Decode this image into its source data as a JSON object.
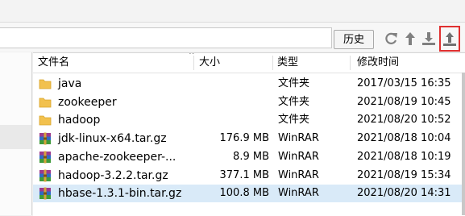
{
  "toolbar": {
    "history_label": "历史",
    "icons": [
      "refresh-icon",
      "arrow-up-icon",
      "download-icon",
      "upload-icon"
    ]
  },
  "columns": {
    "name": "文件名",
    "size": "大小",
    "type": "类型",
    "modified": "修改时间"
  },
  "sort": {
    "column": "name",
    "direction": "ascending",
    "indicator": "^"
  },
  "files": [
    {
      "name": "java",
      "size": "",
      "type": "文件夹",
      "modified": "2017/03/15 16:35",
      "icon": "folder-icon"
    },
    {
      "name": "zookeeper",
      "size": "",
      "type": "文件夹",
      "modified": "2021/08/19 10:45",
      "icon": "folder-icon"
    },
    {
      "name": "hadoop",
      "size": "",
      "type": "文件夹",
      "modified": "2021/08/20 10:52",
      "icon": "folder-icon"
    },
    {
      "name": "jdk-linux-x64.tar.gz",
      "size": "176.9 MB",
      "type": "WinRAR",
      "modified": "2021/08/18 10:04",
      "icon": "winrar-archive-icon"
    },
    {
      "name": "apache-zookeeper-...",
      "size": "8.9 MB",
      "type": "WinRAR",
      "modified": "2021/08/18 10:19",
      "icon": "winrar-archive-icon"
    },
    {
      "name": "hadoop-3.2.2.tar.gz",
      "size": "377.1 MB",
      "type": "WinRAR",
      "modified": "2021/08/19 15:34",
      "icon": "winrar-archive-icon"
    },
    {
      "name": "hbase-1.3.1-bin.tar.gz",
      "size": "100.8 MB",
      "type": "WinRAR",
      "modified": "2021/08/20 14:31",
      "icon": "winrar-archive-icon",
      "selected": true
    }
  ],
  "colors": {
    "selection": "#d9eaf8",
    "highlight_box": "#e03030",
    "folder": "#f2c14e"
  }
}
